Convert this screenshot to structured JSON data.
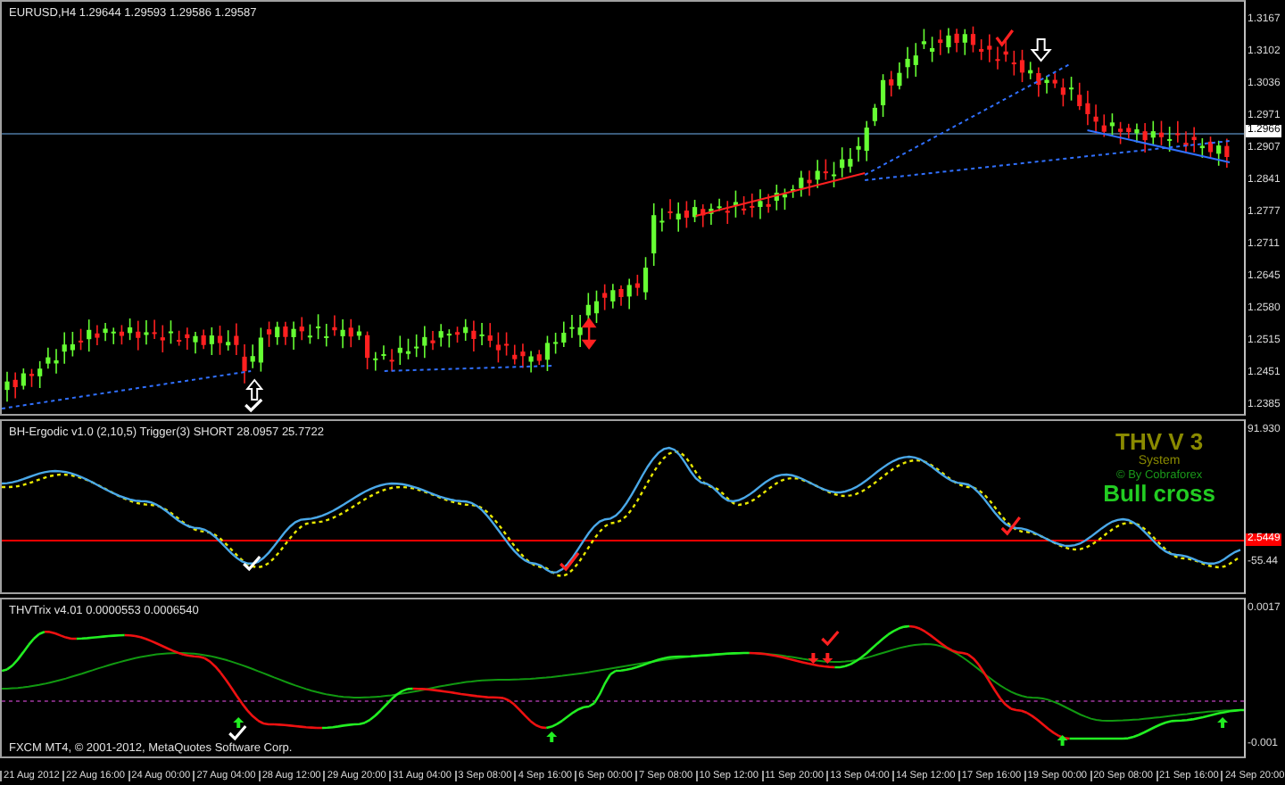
{
  "chart": {
    "symbol_info": "EURUSD,H4  1.29644 1.29593 1.29586 1.29587",
    "price_axis": [
      "1.3167",
      "1.3102",
      "1.3036",
      "1.2971",
      "1.2907",
      "1.2841",
      "1.2777",
      "1.2711",
      "1.2645",
      "1.2580",
      "1.2515",
      "1.2451",
      "1.2385"
    ],
    "current_price": "1.2966"
  },
  "indicator_1": {
    "title": "BH-Ergodic v1.0 (2,10,5) Trigger(3) SHORT 28.0957 25.7722",
    "axis": [
      "91.930",
      "-55.44"
    ],
    "level_tag": "2.5449",
    "overlay": {
      "title": "THV V 3",
      "subtitle": "System",
      "credit": "© By Cobraforex",
      "signal": "Bull cross"
    }
  },
  "indicator_2": {
    "title": "THVTrix v4.01 0.0000553 0.0006540",
    "axis": [
      "0.0017",
      "-0.001"
    ],
    "copyright": "FXCM MT4, © 2001-2012, MetaQuotes Software Corp."
  },
  "time_axis": [
    "21 Aug 2012",
    "22 Aug 16:00",
    "24 Aug 00:00",
    "27 Aug 04:00",
    "28 Aug 12:00",
    "29 Aug 20:00",
    "31 Aug 04:00",
    "3 Sep 08:00",
    "4 Sep 16:00",
    "6 Sep 00:00",
    "7 Sep 08:00",
    "10 Sep 12:00",
    "11 Sep 20:00",
    "13 Sep 04:00",
    "14 Sep 12:00",
    "17 Sep 16:00",
    "19 Sep 00:00",
    "20 Sep 08:00",
    "21 Sep 16:00",
    "24 Sep 20:00"
  ]
}
